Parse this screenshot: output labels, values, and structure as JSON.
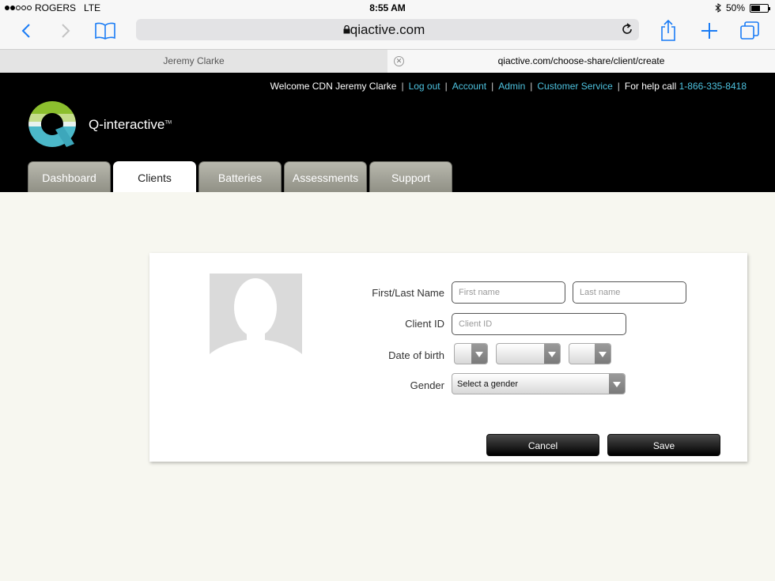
{
  "status_bar": {
    "carrier": "ROGERS",
    "network": "LTE",
    "time": "8:55 AM",
    "battery": "50%",
    "battery_level": 0.5
  },
  "browser": {
    "host": "qiactive.com",
    "tabs": [
      {
        "label": "Jeremy Clarke",
        "active": false
      },
      {
        "label": "qiactive.com/choose-share/client/create",
        "active": true
      }
    ]
  },
  "header": {
    "welcome": "Welcome CDN Jeremy Clarke",
    "links": [
      "Log out",
      "Account",
      "Admin",
      "Customer Service"
    ],
    "help_text": "For help call",
    "phone": "1-866-335-8418",
    "brand": "Q-interactive",
    "brand_tm": "TM",
    "nav_tabs": [
      "Dashboard",
      "Clients",
      "Batteries",
      "Assessments",
      "Support"
    ],
    "active_tab": "Clients"
  },
  "form": {
    "name_label": "First/Last Name",
    "first_placeholder": "First name",
    "last_placeholder": "Last name",
    "client_id_label": "Client ID",
    "client_id_placeholder": "Client ID",
    "dob_label": "Date of birth",
    "gender_label": "Gender",
    "gender_value": "Select a gender",
    "cancel": "Cancel",
    "save": "Save"
  },
  "colors": {
    "link": "#4ec3e0",
    "header_bg": "#000000",
    "page_bg": "#f7f7f0"
  }
}
